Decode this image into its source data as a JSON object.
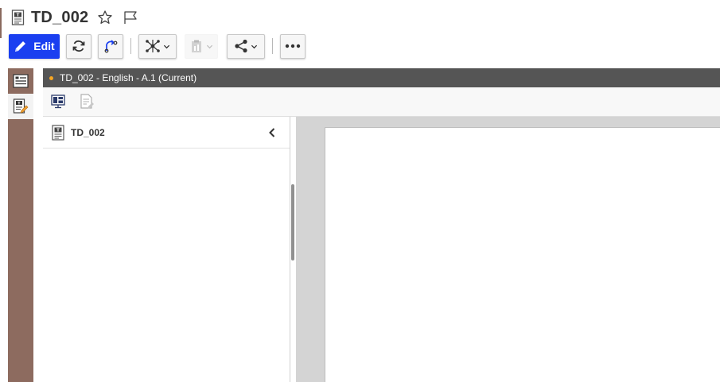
{
  "header": {
    "title": "TD_002",
    "title_icon": "document-type-icon",
    "favorite_icon": "star-icon",
    "flag_icon": "flag-icon"
  },
  "toolbar": {
    "edit_label": "Edit",
    "edit_color": "#1a3ff0",
    "buttons": [
      "refresh-icon",
      "revise-icon",
      "structure-icon",
      "clipboard-icon",
      "share-icon",
      "more-icon"
    ]
  },
  "sidebar": {
    "color": "#8d6b5f",
    "tabs": [
      "properties-tab-icon",
      "document-edit-tab-icon"
    ]
  },
  "document": {
    "header_text": "TD_002 - English - A.1 (Current)",
    "status_dot_color": "#f5a623"
  },
  "tree": {
    "root_label": "TD_002"
  }
}
